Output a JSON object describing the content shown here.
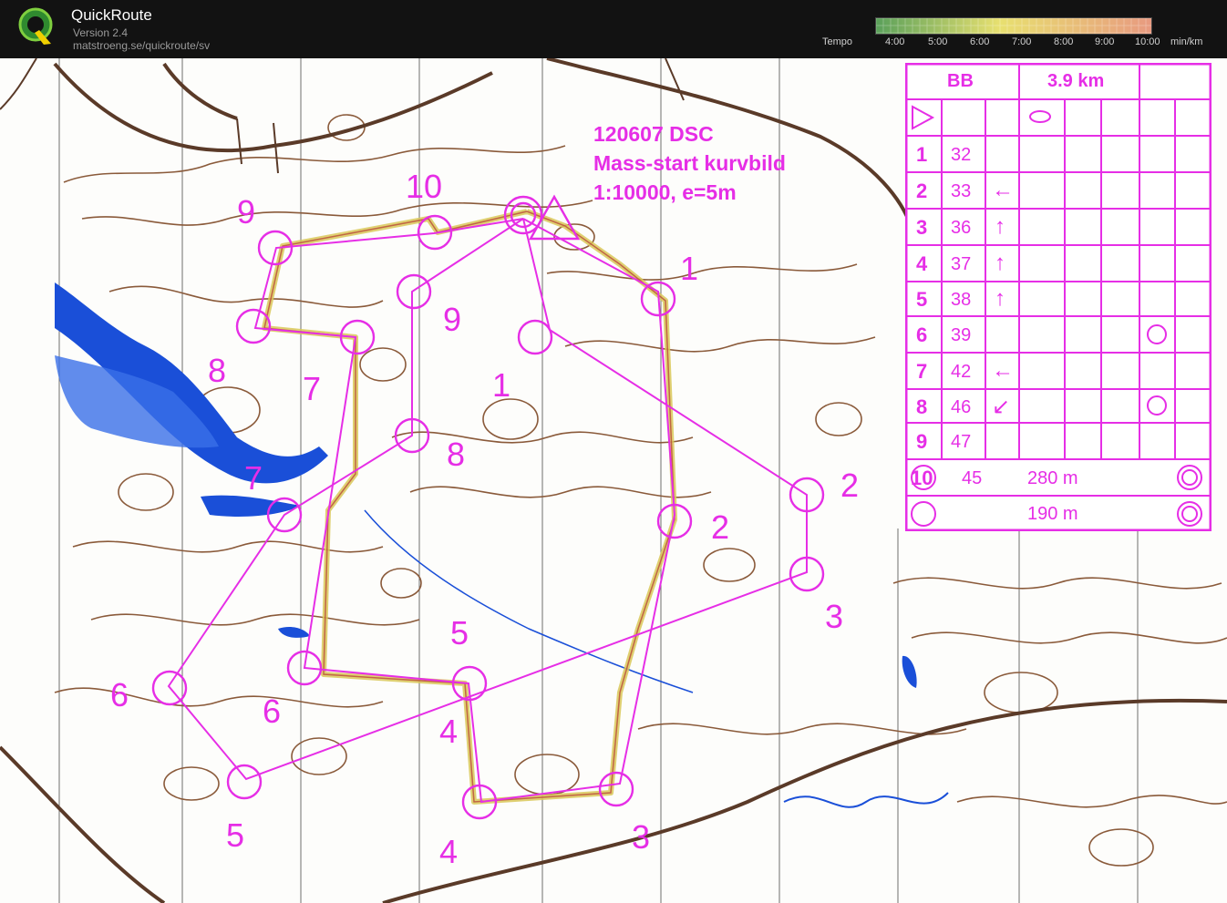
{
  "app": {
    "title": "QuickRoute",
    "version": "Version 2.4",
    "url": "matstroeng.se/quickroute/sv"
  },
  "tempo": {
    "label": "Tempo",
    "ticks": [
      "4:00",
      "5:00",
      "6:00",
      "7:00",
      "8:00",
      "9:00",
      "10:00"
    ],
    "unit": "min/km",
    "colors": [
      "#5aa05a",
      "#e8e070",
      "#e89a80"
    ]
  },
  "map": {
    "course_info": {
      "line1": "120607 DSC",
      "line2": "Mass-start kurvbild",
      "line3": "1:10000, e=5m"
    },
    "course_color": "#e62ee6",
    "route_color": "#c8b050",
    "contour_color": "#8a5a3a",
    "water_color": "#1a4fd8",
    "control_numbers_a": [
      "1",
      "2",
      "3",
      "4",
      "5",
      "6",
      "7",
      "8",
      "9",
      "10"
    ],
    "control_numbers_b": [
      "1",
      "2",
      "3",
      "4",
      "5",
      "6",
      "7",
      "8",
      "9"
    ]
  },
  "description": {
    "header_left": "BB",
    "header_distance": "3.9 km",
    "rows": [
      {
        "num": "1",
        "code": "32",
        "dir": "",
        "feature": ""
      },
      {
        "num": "2",
        "code": "33",
        "dir": "←",
        "feature": ""
      },
      {
        "num": "3",
        "code": "36",
        "dir": "↑",
        "feature": ""
      },
      {
        "num": "4",
        "code": "37",
        "dir": "↑",
        "feature": ""
      },
      {
        "num": "5",
        "code": "38",
        "dir": "↑",
        "feature": ""
      },
      {
        "num": "6",
        "code": "39",
        "dir": "",
        "feature": ""
      },
      {
        "num": "7",
        "code": "42",
        "dir": "←",
        "feature": ""
      },
      {
        "num": "8",
        "code": "46",
        "dir": "↙",
        "feature": ""
      },
      {
        "num": "9",
        "code": "47",
        "dir": "",
        "feature": ""
      },
      {
        "num": "10",
        "code": "45",
        "dir": "",
        "feature": ""
      }
    ],
    "row10_distance": "280 m",
    "finish_distance": "190 m"
  }
}
